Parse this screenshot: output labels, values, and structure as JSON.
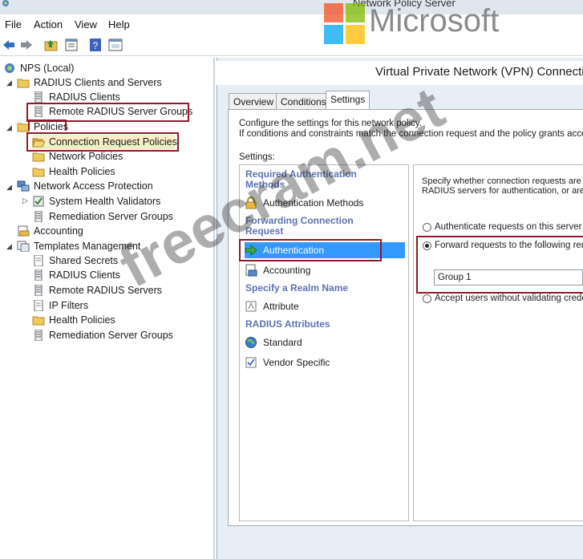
{
  "window": {
    "title": "Network Policy Server"
  },
  "menu": {
    "items": [
      "File",
      "Action",
      "View",
      "Help"
    ]
  },
  "toolbar": {
    "icons": [
      "back-arrow-icon",
      "forward-arrow-icon",
      "folder-up-icon",
      "properties-icon",
      "help-icon",
      "console-icon"
    ]
  },
  "tree": {
    "root": "NPS (Local)",
    "radius_clients_servers": "RADIUS Clients and Servers",
    "radius_clients": "RADIUS Clients",
    "remote_groups": "Remote RADIUS Server Groups",
    "policies": "Policies",
    "connection_request_policies": "Connection Request Policies",
    "network_policies": "Network Policies",
    "health_policies": "Health Policies",
    "nap": "Network Access Protection",
    "shv": "System Health Validators",
    "remediation_groups": "Remediation Server Groups",
    "accounting": "Accounting",
    "templates": "Templates Management",
    "shared_secrets": "Shared Secrets",
    "t_radius_clients": "RADIUS Clients",
    "t_remote_servers": "Remote RADIUS Servers",
    "ip_filters": "IP Filters",
    "t_health_policies": "Health Policies",
    "t_remediation_groups": "Remediation Server Groups"
  },
  "dialog": {
    "header": "Virtual Private Network (VPN) Connecti",
    "tabs": [
      "Overview",
      "Conditions",
      "Settings"
    ],
    "active_tab": "Settings",
    "intro_line1": "Configure the settings for this network policy.",
    "intro_line2": "If conditions and constraints match the connection request and the policy grants access,",
    "settings_label": "Settings:",
    "categories": {
      "required_auth_1": "Required Authentication",
      "required_auth_2": "Methods",
      "forwarding_1": "Forwarding Connection",
      "forwarding_2": "Request",
      "realm": "Specify a Realm Name",
      "radius_attr": "RADIUS Attributes"
    },
    "items": {
      "auth_methods": "Authentication Methods",
      "authentication": "Authentication",
      "accounting": "Accounting",
      "attribute": "Attribute",
      "standard": "Standard",
      "vendor_specific": "Vendor Specific"
    },
    "detail": {
      "desc1": "Specify whether connection requests are p",
      "desc2": "RADIUS servers for authentication, or are",
      "opt_local": "Authenticate requests on this server",
      "opt_forward": "Forward requests to the following remo",
      "group_value": "Group 1",
      "opt_accept": "Accept users without validating creden"
    }
  },
  "branding": {
    "logo_text": "Microsoft",
    "logo_colors": [
      "#f25022",
      "#7fba00",
      "#00a4ef",
      "#ffb900"
    ]
  },
  "watermark": "freecram.net",
  "colors": {
    "highlight_box": "#8b1c2c",
    "selected_item": "#3399ff",
    "category_text": "#5b73b0"
  }
}
